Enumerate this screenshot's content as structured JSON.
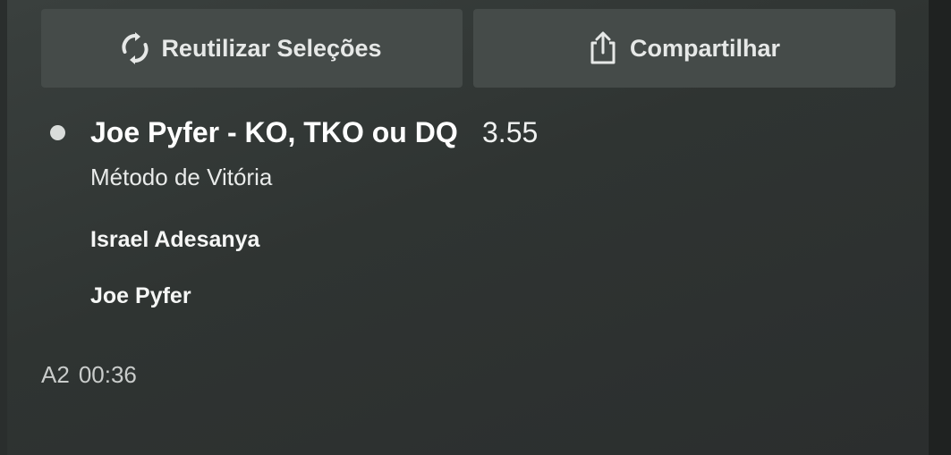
{
  "actions": {
    "reuse_label": "Reutilizar Seleções",
    "reuse_icon": "refresh-icon",
    "share_label": "Compartilhar",
    "share_icon": "share-icon"
  },
  "selection": {
    "title": "Joe Pyfer - KO, TKO ou DQ",
    "odds": "3.55",
    "market": "Método de Vitória",
    "fighters": [
      "Israel Adesanya",
      "Joe Pyfer"
    ]
  },
  "event": {
    "round": "A2",
    "time": "00:36"
  },
  "colors": {
    "background": "#2f3432",
    "button": "#454b49",
    "text": "#ffffff"
  }
}
